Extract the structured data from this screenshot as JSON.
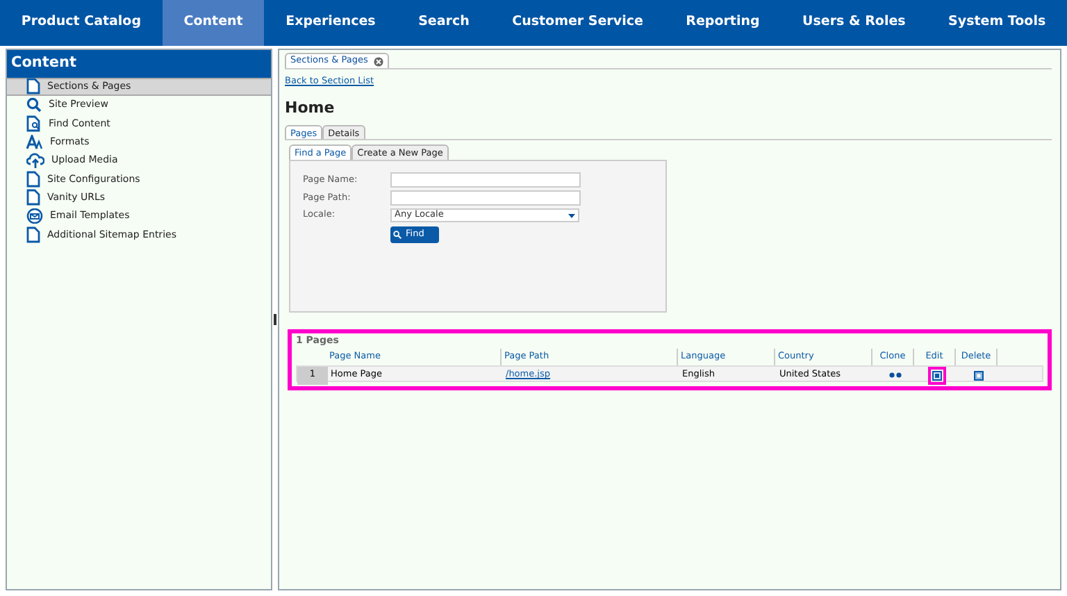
{
  "nav": [
    {
      "label": "Product Catalog",
      "selected": false
    },
    {
      "label": "Content",
      "selected": true
    },
    {
      "label": "Experiences",
      "selected": false
    },
    {
      "label": "Search",
      "selected": false
    },
    {
      "label": "Customer Service",
      "selected": false
    },
    {
      "label": "Reporting",
      "selected": false
    },
    {
      "label": "Users & Roles",
      "selected": false
    },
    {
      "label": "System Tools",
      "selected": false
    }
  ],
  "sidebar": {
    "title": "Content",
    "items": [
      {
        "label": "Sections & Pages",
        "kind": "page",
        "selected": true
      },
      {
        "label": "Site Preview",
        "kind": "search",
        "selected": false
      },
      {
        "label": "Find Content",
        "kind": "find",
        "selected": false
      },
      {
        "label": "Formats",
        "kind": "format",
        "selected": false
      },
      {
        "label": "Upload Media",
        "kind": "upload",
        "selected": false
      },
      {
        "label": "Site Configurations",
        "kind": "page",
        "selected": false
      },
      {
        "label": "Vanity URLs",
        "kind": "page",
        "selected": false
      },
      {
        "label": "Email Templates",
        "kind": "email",
        "selected": false
      },
      {
        "label": "Additional Sitemap Entries",
        "kind": "page",
        "selected": false
      }
    ]
  },
  "document_tab": {
    "label": "Sections & Pages"
  },
  "back_link": "Back to Section List",
  "heading": "Home",
  "tabs": [
    {
      "label": "Pages",
      "selected": true
    },
    {
      "label": "Details",
      "selected": false
    }
  ],
  "subtabs": [
    {
      "label": "Find a Page",
      "selected": true
    },
    {
      "label": "Create a New Page",
      "selected": false
    }
  ],
  "form": {
    "fields": [
      {
        "label": "Page Name:",
        "kind": "text"
      },
      {
        "label": "Page Path:",
        "kind": "text"
      },
      {
        "label": "Locale:",
        "kind": "select",
        "value": "Any Locale"
      }
    ],
    "button": "Find"
  },
  "results": {
    "title": "1 Pages",
    "highlighted": true,
    "columns": [
      "Page Name",
      "Page Path",
      "Language",
      "Country",
      "Clone",
      "Edit",
      "Delete"
    ],
    "rows": [
      {
        "number": "1",
        "page_name": "Home Page",
        "page_path": "/home.jsp",
        "language": "English",
        "country": "United States",
        "edit_highlighted": true
      }
    ]
  }
}
